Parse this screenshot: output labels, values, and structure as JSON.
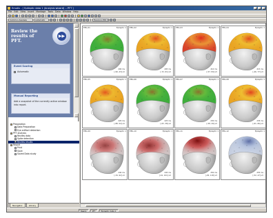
{
  "window": {
    "title": "Emotiv - [ Epileptic data 1 (Analysis wizard) -- PFT ]"
  },
  "menu": [
    "File",
    "Edit",
    "View",
    "Insert",
    "Montage",
    "Tools",
    "Data",
    "Window",
    "Help"
  ],
  "toolbar": {
    "montage_combo": "Common Average",
    "mode_combo": "Automatic",
    "range_combo": "Hanning 256 ms"
  },
  "task_pane": {
    "title": "Review the results of PFT.",
    "logo_label": "▶▶",
    "panel_scoring_title": "Event Scoring",
    "panel_scoring_option": "Automatic",
    "panel_reporting_title": "Manual Reporting",
    "panel_reporting_text": "Add a snapshot of the currently active window into report."
  },
  "tree": [
    {
      "label": "Preparation",
      "level": 0,
      "icon": "folder-icon"
    },
    {
      "label": "Data Preparation",
      "level": 1,
      "icon": "doc-icon"
    },
    {
      "label": "Eye artifact detection",
      "level": 1,
      "icon": "doc-icon"
    },
    {
      "label": "PFT analysis",
      "level": 0,
      "icon": "folder-icon"
    },
    {
      "label": "Review data",
      "level": 1,
      "icon": "doc-icon"
    },
    {
      "label": "Spike detection",
      "level": 1,
      "icon": "doc-icon"
    },
    {
      "label": "Review results",
      "level": 1,
      "icon": "doc-icon",
      "selected": true
    },
    {
      "label": "Report",
      "level": 0,
      "icon": "folder-icon"
    },
    {
      "label": "Print",
      "level": 1,
      "icon": "doc-icon"
    },
    {
      "label": "Save",
      "level": 1,
      "icon": "doc-icon"
    },
    {
      "label": "Saved Data study",
      "level": 1,
      "icon": "doc-icon"
    }
  ],
  "left_tabs": [
    "Navigator",
    "Library"
  ],
  "colors": {
    "task_pane_bg": "#6b7faa",
    "title_bar": "#0a246a",
    "selection": "#0a246a",
    "map_high": "#e02a1c",
    "map_mid": "#f2c428",
    "map_low": "#3fae3c"
  },
  "maps": [
    {
      "label": "EEG-01",
      "time": "200 ms",
      "source": "Epileptic 1",
      "range": "[-99, 43] uV",
      "type": "green",
      "hot_x": 0.55,
      "hot_y": 0.35,
      "intensity": 0.15
    },
    {
      "label": "EEG-02",
      "time": "205 ms",
      "source": "Epileptic 1",
      "range": "[-72, 61] uV",
      "type": "orange",
      "hot_x": 0.6,
      "hot_y": 0.32,
      "intensity": 0.55
    },
    {
      "label": "EEG-03",
      "time": "210 ms",
      "source": "Epileptic 1",
      "range": "[-57, 84] uV",
      "type": "red",
      "hot_x": 0.58,
      "hot_y": 0.3,
      "intensity": 0.9
    },
    {
      "label": "EEG-04",
      "time": "215 ms",
      "source": "Epileptic 1",
      "range": "[-46, 77] uV",
      "type": "orange",
      "hot_x": 0.62,
      "hot_y": 0.33,
      "intensity": 0.6
    },
    {
      "label": "EEG-05",
      "time": "220 ms",
      "source": "Epileptic 1",
      "range": "[-88, 52] uV",
      "type": "orange",
      "hot_x": 0.5,
      "hot_y": 0.4,
      "intensity": 0.45
    },
    {
      "label": "EEG-06",
      "time": "225 ms",
      "source": "Epileptic 1",
      "range": "[-63, 38] uV",
      "type": "green",
      "hot_x": 0.52,
      "hot_y": 0.38,
      "intensity": 0.2
    },
    {
      "label": "EEG-07",
      "time": "230 ms",
      "source": "Epileptic 1",
      "range": "[-58, 29] uV",
      "type": "green",
      "hot_x": 0.52,
      "hot_y": 0.38,
      "intensity": 0.2
    },
    {
      "label": "EEG-08",
      "time": "235 ms",
      "source": "Epileptic 1",
      "range": "[-61, 66] uV",
      "type": "orange",
      "hot_x": 0.66,
      "hot_y": 0.4,
      "intensity": 0.7
    },
    {
      "label": "EEG-09",
      "time": "240 ms",
      "source": "Epileptic 1",
      "range": "[-34, 92] uV",
      "type": "pale",
      "hot_x": 0.5,
      "hot_y": 0.45,
      "intensity": 0.55
    },
    {
      "label": "EEG-10",
      "time": "245 ms",
      "source": "Epileptic 1",
      "range": "[-41, 101] uV",
      "type": "pale",
      "hot_x": 0.45,
      "hot_y": 0.45,
      "intensity": 0.7
    },
    {
      "label": "EEG-11",
      "time": "250 ms",
      "source": "Epileptic 1",
      "range": "[-29, 118] uV",
      "type": "pale",
      "hot_x": 0.5,
      "hot_y": 0.28,
      "intensity": 0.95
    },
    {
      "label": "EEG-12",
      "time": "255 ms",
      "source": "Epileptic 1",
      "range": "[-52, 47] uV",
      "type": "blue",
      "hot_x": 0.62,
      "hot_y": 0.3,
      "intensity": 0.5
    }
  ],
  "status": [
    "Ready",
    "PFT",
    "Epileptic data 1"
  ]
}
